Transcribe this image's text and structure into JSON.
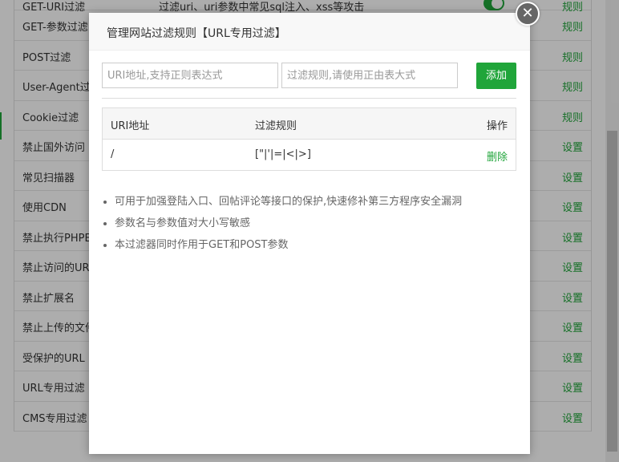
{
  "background": {
    "rows": [
      {
        "name": "GET-URI过滤",
        "desc": "过滤uri、uri参数中常见sql注入、xss等攻击",
        "action": "规则",
        "toggle": true
      },
      {
        "name": "GET-参数过滤",
        "desc": "",
        "action": "规则"
      },
      {
        "name": "POST过滤",
        "desc": "",
        "action": "规则"
      },
      {
        "name": "User-Agent过",
        "desc": "",
        "action": "规则"
      },
      {
        "name": "Cookie过滤",
        "desc": "",
        "action": "规则"
      },
      {
        "name": "禁止国外访问",
        "desc": "",
        "action": "设置"
      },
      {
        "name": "常见扫描器",
        "desc": "",
        "action": "设置"
      },
      {
        "name": "使用CDN",
        "desc": "",
        "action": "设置"
      },
      {
        "name": "禁止执行PHPE",
        "desc": "",
        "action": "设置"
      },
      {
        "name": "禁止访问的UR",
        "desc": "",
        "action": "设置"
      },
      {
        "name": "禁止扩展名",
        "desc": "",
        "action": "设置"
      },
      {
        "name": "禁止上传的文件",
        "desc": "",
        "action": "设置"
      },
      {
        "name": "受保护的URL",
        "desc": "",
        "action": "设置"
      },
      {
        "name": "URL专用过滤",
        "desc": "",
        "action": "设置"
      },
      {
        "name": "CMS专用过滤",
        "desc": "",
        "action": "设置"
      }
    ]
  },
  "modal": {
    "title": "管理网站过滤规则【URL专用过滤】",
    "close_icon": "close-icon",
    "url_placeholder": "URI地址,支持正则表达式",
    "rule_placeholder": "过滤规则,请使用正由表大式",
    "add_label": "添加",
    "table": {
      "headers": [
        "URI地址",
        "过滤规则",
        "操作"
      ],
      "rows": [
        {
          "uri": "/",
          "rule": "[\"|'|=|<|>]",
          "action": "删除"
        }
      ]
    },
    "notes": [
      "可用于加强登陆入口、回帖评论等接口的保护,快速修补第三方程序安全漏洞",
      "参数名与参数值对大小写敏感",
      "本过滤器同时作用于GET和POST参数"
    ]
  },
  "colors": {
    "accent": "#20a53a",
    "overlay": "rgba(0,0,0,0.32)"
  }
}
